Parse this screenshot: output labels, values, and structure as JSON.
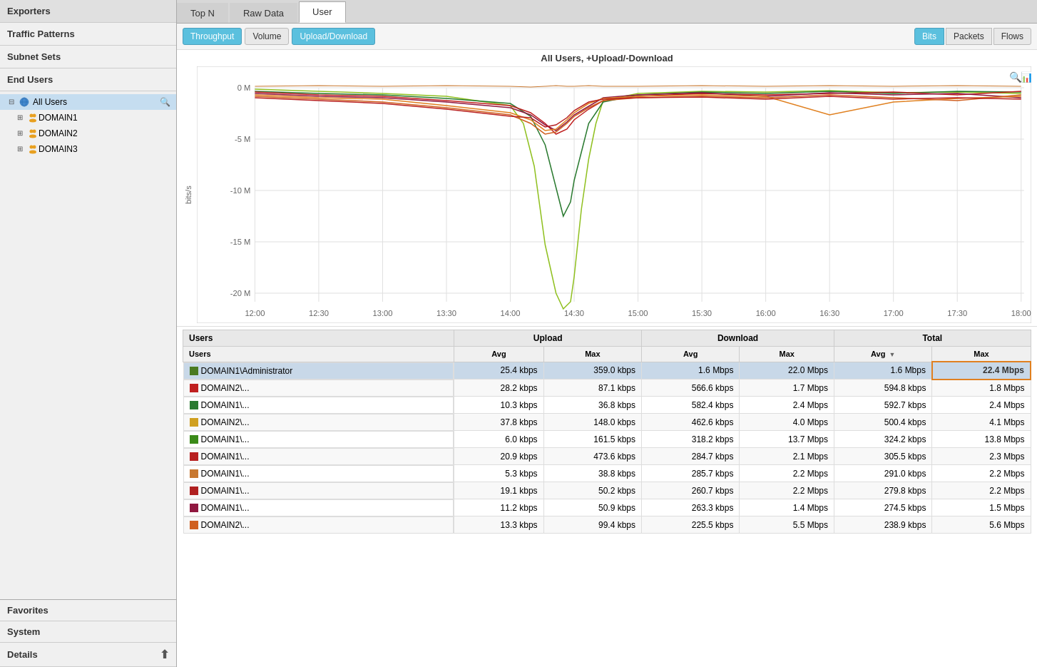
{
  "sidebar": {
    "sections": [
      {
        "id": "exporters",
        "label": "Exporters"
      },
      {
        "id": "traffic-patterns",
        "label": "Traffic Patterns"
      },
      {
        "id": "subnet-sets",
        "label": "Subnet Sets"
      },
      {
        "id": "end-users",
        "label": "End Users"
      }
    ],
    "tree": {
      "root": {
        "label": "All Users",
        "active": true
      },
      "domains": [
        {
          "label": "DOMAIN1",
          "expanded": false
        },
        {
          "label": "DOMAIN2",
          "expanded": false
        },
        {
          "label": "DOMAIN3",
          "expanded": false
        }
      ]
    },
    "bottom_sections": [
      {
        "id": "favorites",
        "label": "Favorites"
      },
      {
        "id": "system",
        "label": "System"
      },
      {
        "id": "details",
        "label": "Details",
        "has_arrow": true
      }
    ]
  },
  "top_tabs": [
    {
      "id": "top-n",
      "label": "Top N",
      "active": false
    },
    {
      "id": "raw-data",
      "label": "Raw Data",
      "active": false
    },
    {
      "id": "user",
      "label": "User",
      "active": true
    }
  ],
  "toolbar": {
    "left_buttons": [
      {
        "id": "throughput",
        "label": "Throughput",
        "active": true
      },
      {
        "id": "volume",
        "label": "Volume",
        "active": false
      },
      {
        "id": "upload-download",
        "label": "Upload/Download",
        "active": true
      }
    ],
    "right_buttons": [
      {
        "id": "bits",
        "label": "Bits",
        "active": true
      },
      {
        "id": "packets",
        "label": "Packets",
        "active": false
      },
      {
        "id": "flows",
        "label": "Flows",
        "active": false
      }
    ]
  },
  "chart": {
    "title": "All Users, +Upload/-Download",
    "y_label": "bits/s",
    "y_ticks": [
      "0 M",
      "-5 M",
      "-10 M",
      "-15 M",
      "-20 M"
    ],
    "x_ticks": [
      "12:00",
      "12:30",
      "13:00",
      "13:30",
      "14:00",
      "14:30",
      "15:00",
      "15:30",
      "16:00",
      "16:30",
      "17:00",
      "17:30",
      "18:00"
    ]
  },
  "table": {
    "col_groups": [
      {
        "label": "Users",
        "colspan": 1
      },
      {
        "label": "Upload",
        "colspan": 2
      },
      {
        "label": "Download",
        "colspan": 2
      },
      {
        "label": "Total",
        "colspan": 2
      }
    ],
    "col_headers": [
      "Users",
      "Avg",
      "Max",
      "Avg",
      "Max",
      "Avg",
      "Max"
    ],
    "rows": [
      {
        "color": "#4a7a20",
        "name": "DOMAIN1\\Administrator",
        "ul_avg": "25.4 kbps",
        "ul_max": "359.0 kbps",
        "dl_avg": "1.6 Mbps",
        "dl_max": "22.0 Mbps",
        "tot_avg": "1.6 Mbps",
        "tot_max": "22.4 Mbps",
        "highlighted_col": "tot_max",
        "row_highlight": true
      },
      {
        "color": "#c02020",
        "name": "DOMAIN2\\...",
        "ul_avg": "28.2 kbps",
        "ul_max": "87.1 kbps",
        "dl_avg": "566.6 kbps",
        "dl_max": "1.7 Mbps",
        "tot_avg": "594.8 kbps",
        "tot_max": "1.8 Mbps",
        "highlighted_col": null,
        "row_highlight": false
      },
      {
        "color": "#2a7a30",
        "name": "DOMAIN1\\...",
        "ul_avg": "10.3 kbps",
        "ul_max": "36.8 kbps",
        "dl_avg": "582.4 kbps",
        "dl_max": "2.4 Mbps",
        "tot_avg": "592.7 kbps",
        "tot_max": "2.4 Mbps",
        "highlighted_col": null,
        "row_highlight": false
      },
      {
        "color": "#d0a020",
        "name": "DOMAIN2\\...",
        "ul_avg": "37.8 kbps",
        "ul_max": "148.0 kbps",
        "dl_avg": "462.6 kbps",
        "dl_max": "4.0 Mbps",
        "tot_avg": "500.4 kbps",
        "tot_max": "4.1 Mbps",
        "highlighted_col": null,
        "row_highlight": false
      },
      {
        "color": "#3a8a18",
        "name": "DOMAIN1\\...",
        "ul_avg": "6.0 kbps",
        "ul_max": "161.5 kbps",
        "dl_avg": "318.2 kbps",
        "dl_max": "13.7 Mbps",
        "tot_avg": "324.2 kbps",
        "tot_max": "13.8 Mbps",
        "highlighted_col": null,
        "row_highlight": false
      },
      {
        "color": "#b82020",
        "name": "DOMAIN1\\...",
        "ul_avg": "20.9 kbps",
        "ul_max": "473.6 kbps",
        "dl_avg": "284.7 kbps",
        "dl_max": "2.1 Mbps",
        "tot_avg": "305.5 kbps",
        "tot_max": "2.3 Mbps",
        "highlighted_col": null,
        "row_highlight": false
      },
      {
        "color": "#c87830",
        "name": "DOMAIN1\\...",
        "ul_avg": "5.3 kbps",
        "ul_max": "38.8 kbps",
        "dl_avg": "285.7 kbps",
        "dl_max": "2.2 Mbps",
        "tot_avg": "291.0 kbps",
        "tot_max": "2.2 Mbps",
        "highlighted_col": null,
        "row_highlight": false
      },
      {
        "color": "#b02020",
        "name": "DOMAIN1\\...",
        "ul_avg": "19.1 kbps",
        "ul_max": "50.2 kbps",
        "dl_avg": "260.7 kbps",
        "dl_max": "2.2 Mbps",
        "tot_avg": "279.8 kbps",
        "tot_max": "2.2 Mbps",
        "highlighted_col": null,
        "row_highlight": false
      },
      {
        "color": "#901840",
        "name": "DOMAIN1\\...",
        "ul_avg": "11.2 kbps",
        "ul_max": "50.9 kbps",
        "dl_avg": "263.3 kbps",
        "dl_max": "1.4 Mbps",
        "tot_avg": "274.5 kbps",
        "tot_max": "1.5 Mbps",
        "highlighted_col": null,
        "row_highlight": false
      },
      {
        "color": "#d06020",
        "name": "DOMAIN2\\...",
        "ul_avg": "13.3 kbps",
        "ul_max": "99.4 kbps",
        "dl_avg": "225.5 kbps",
        "dl_max": "5.5 Mbps",
        "tot_avg": "238.9 kbps",
        "tot_max": "5.6 Mbps",
        "highlighted_col": null,
        "row_highlight": false
      }
    ]
  },
  "icons": {
    "search": "🔍",
    "zoom_in": "🔍",
    "chart_icon": "📊",
    "expand": "➕",
    "collapse": "➖",
    "sort_desc": "▼",
    "up_arrow": "▲"
  }
}
